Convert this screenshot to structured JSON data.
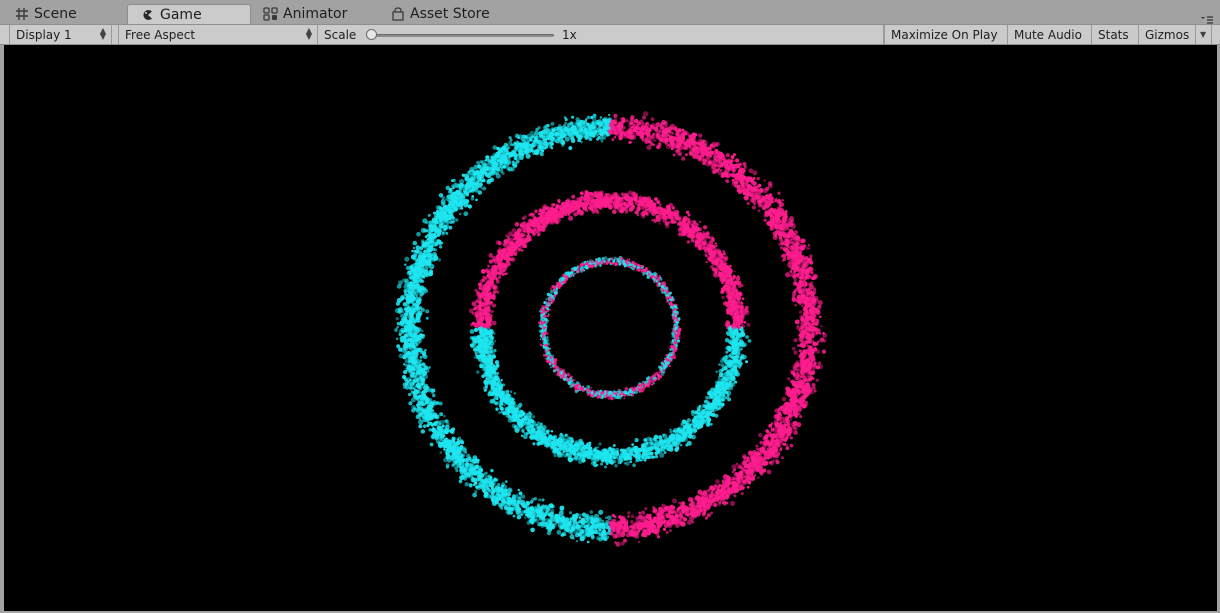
{
  "tabs": [
    {
      "label": "Scene",
      "icon": "grid-icon",
      "active": false
    },
    {
      "label": "Game",
      "icon": "game-icon",
      "active": true
    },
    {
      "label": "Animator",
      "icon": "animator-icon",
      "active": false
    },
    {
      "label": "Asset Store",
      "icon": "asset-store-icon",
      "active": false
    }
  ],
  "toolbar": {
    "display": "Display 1",
    "aspect": "Free Aspect",
    "scale_label": "Scale",
    "scale_value": "1x",
    "maximize_on_play": "Maximize On Play",
    "mute_audio": "Mute Audio",
    "stats": "Stats",
    "gizmos": "Gizmos"
  },
  "game_view": {
    "background": "#000000",
    "particle_colors": {
      "cyan": "#1ee6f0",
      "pink": "#ff1d8e"
    },
    "rings": [
      {
        "name": "outer",
        "left_half": "cyan",
        "right_half": "pink"
      },
      {
        "name": "middle",
        "top_half": "pink",
        "bottom_half": "cyan"
      },
      {
        "name": "inner",
        "mixed": [
          "cyan",
          "pink"
        ]
      }
    ]
  }
}
